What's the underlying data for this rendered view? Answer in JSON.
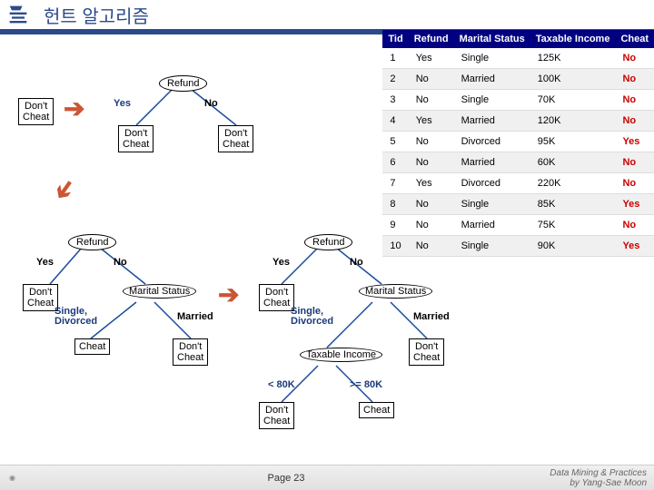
{
  "header": {
    "title": "헌트 알고리즘"
  },
  "table": {
    "headers": [
      "Tid",
      "Refund",
      "Marital Status",
      "Taxable Income",
      "Cheat"
    ],
    "rows": [
      {
        "tid": "1",
        "refund": "Yes",
        "marital": "Single",
        "income": "125K",
        "cheat": "No"
      },
      {
        "tid": "2",
        "refund": "No",
        "marital": "Married",
        "income": "100K",
        "cheat": "No"
      },
      {
        "tid": "3",
        "refund": "No",
        "marital": "Single",
        "income": "70K",
        "cheat": "No"
      },
      {
        "tid": "4",
        "refund": "Yes",
        "marital": "Married",
        "income": "120K",
        "cheat": "No"
      },
      {
        "tid": "5",
        "refund": "No",
        "marital": "Divorced",
        "income": "95K",
        "cheat": "Yes"
      },
      {
        "tid": "6",
        "refund": "No",
        "marital": "Married",
        "income": "60K",
        "cheat": "No"
      },
      {
        "tid": "7",
        "refund": "Yes",
        "marital": "Divorced",
        "income": "220K",
        "cheat": "No"
      },
      {
        "tid": "8",
        "refund": "No",
        "marital": "Single",
        "income": "85K",
        "cheat": "Yes"
      },
      {
        "tid": "9",
        "refund": "No",
        "marital": "Married",
        "income": "75K",
        "cheat": "No"
      },
      {
        "tid": "10",
        "refund": "No",
        "marital": "Single",
        "income": "90K",
        "cheat": "Yes"
      }
    ]
  },
  "labels": {
    "refund": "Refund",
    "marital": "Marital Status",
    "taxable": "Taxable Income",
    "dont_cheat": "Don't Cheat",
    "dont_cheat2": "Don't\nCheat",
    "cheat": "Cheat",
    "yes": "Yes",
    "no": "No",
    "single_div": "Single, Divorced",
    "married": "Married",
    "lt80": "< 80K",
    "ge80": ">= 80K"
  },
  "footer": {
    "page": "Page 23",
    "credit1": "Data Mining & Practices",
    "credit2": "by Yang-Sae Moon"
  }
}
